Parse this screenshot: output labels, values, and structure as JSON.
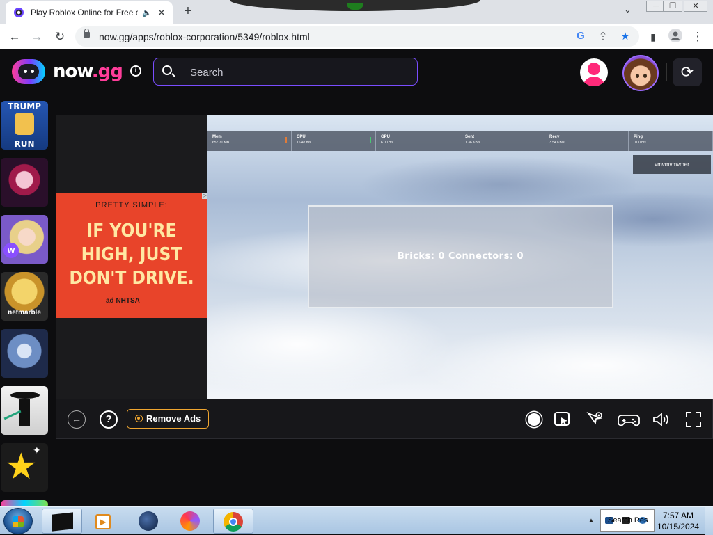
{
  "browser": {
    "tab": {
      "title": "Play Roblox Online for Free o",
      "close": "✕"
    },
    "new_tab": "+",
    "tab_menu": "⌄",
    "window_controls": {
      "minimize": "─",
      "restore": "❐",
      "close": "✕"
    },
    "nav": {
      "back": "←",
      "forward": "→",
      "reload": "↻"
    },
    "address": {
      "url": "now.gg/apps/roblox-corporation/5349/roblox.html"
    },
    "toolbar_icons": [
      "google-lens-icon",
      "share-icon",
      "bookmark-star-icon",
      "side-panel-icon",
      "profile-icon",
      "menu-icon"
    ]
  },
  "site": {
    "logo": {
      "text_main": "now",
      "text_suffix": ".gg"
    },
    "info": "i",
    "search": {
      "placeholder": "Search"
    },
    "refresh": "⟳"
  },
  "sidebar": {
    "games": [
      {
        "name": "trump-run",
        "label_top": "TRUMP",
        "label_bottom": "RUN",
        "color": "#1d4fa3"
      },
      {
        "name": "anime-dark-girl",
        "color": "#3a1030"
      },
      {
        "name": "blonde-girl",
        "color": "#6b4aa8"
      },
      {
        "name": "netmarble-game",
        "label_bottom": "netmarble",
        "color": "#c7a23a"
      },
      {
        "name": "blue-hero",
        "color": "#3b5a8f"
      },
      {
        "name": "shadow-fight",
        "color": "#d8d8d8"
      },
      {
        "name": "star-game",
        "color": "#1b1b1b"
      }
    ]
  },
  "ad": {
    "kicker": "PRETTY SIMPLE:",
    "headline_1": "IF YOU'RE",
    "headline_2": "HIGH, JUST",
    "headline_3": "DON'T DRIVE.",
    "sponsor": "ad   NHTSA",
    "adchoices": "▷"
  },
  "game": {
    "stats": [
      {
        "name": "Mem",
        "value": "657.71 MB",
        "marker_color": "#e07b39"
      },
      {
        "name": "CPU",
        "value": "16.47 ms",
        "marker_color": "#48c774"
      },
      {
        "name": "GPU",
        "value": "6.00 ms",
        "marker_color": ""
      },
      {
        "name": "Sent",
        "value": "1.36 KB/s",
        "marker_color": ""
      },
      {
        "name": "Recv",
        "value": "3.54 KB/s",
        "marker_color": ""
      },
      {
        "name": "Ping",
        "value": "0.00 ms",
        "marker_color": ""
      }
    ],
    "player_name": "vmvmvmvmer",
    "counter_text": "Bricks: 0   Connectors: 0"
  },
  "controls": {
    "back": "←",
    "help": "?",
    "remove_ads": "Remove Ads",
    "right_icons": [
      "record-icon",
      "screenshot-icon",
      "cursor-settings-icon",
      "gamepad-icon",
      "volume-icon",
      "fullscreen-icon"
    ]
  },
  "taskbar": {
    "apps": [
      "terminal-app",
      "media-player-app",
      "steam-app",
      "firefox-app",
      "chrome-app"
    ],
    "tray_text": "Search Res",
    "clock_time": "7:57 AM",
    "clock_date": "10/15/2024"
  }
}
